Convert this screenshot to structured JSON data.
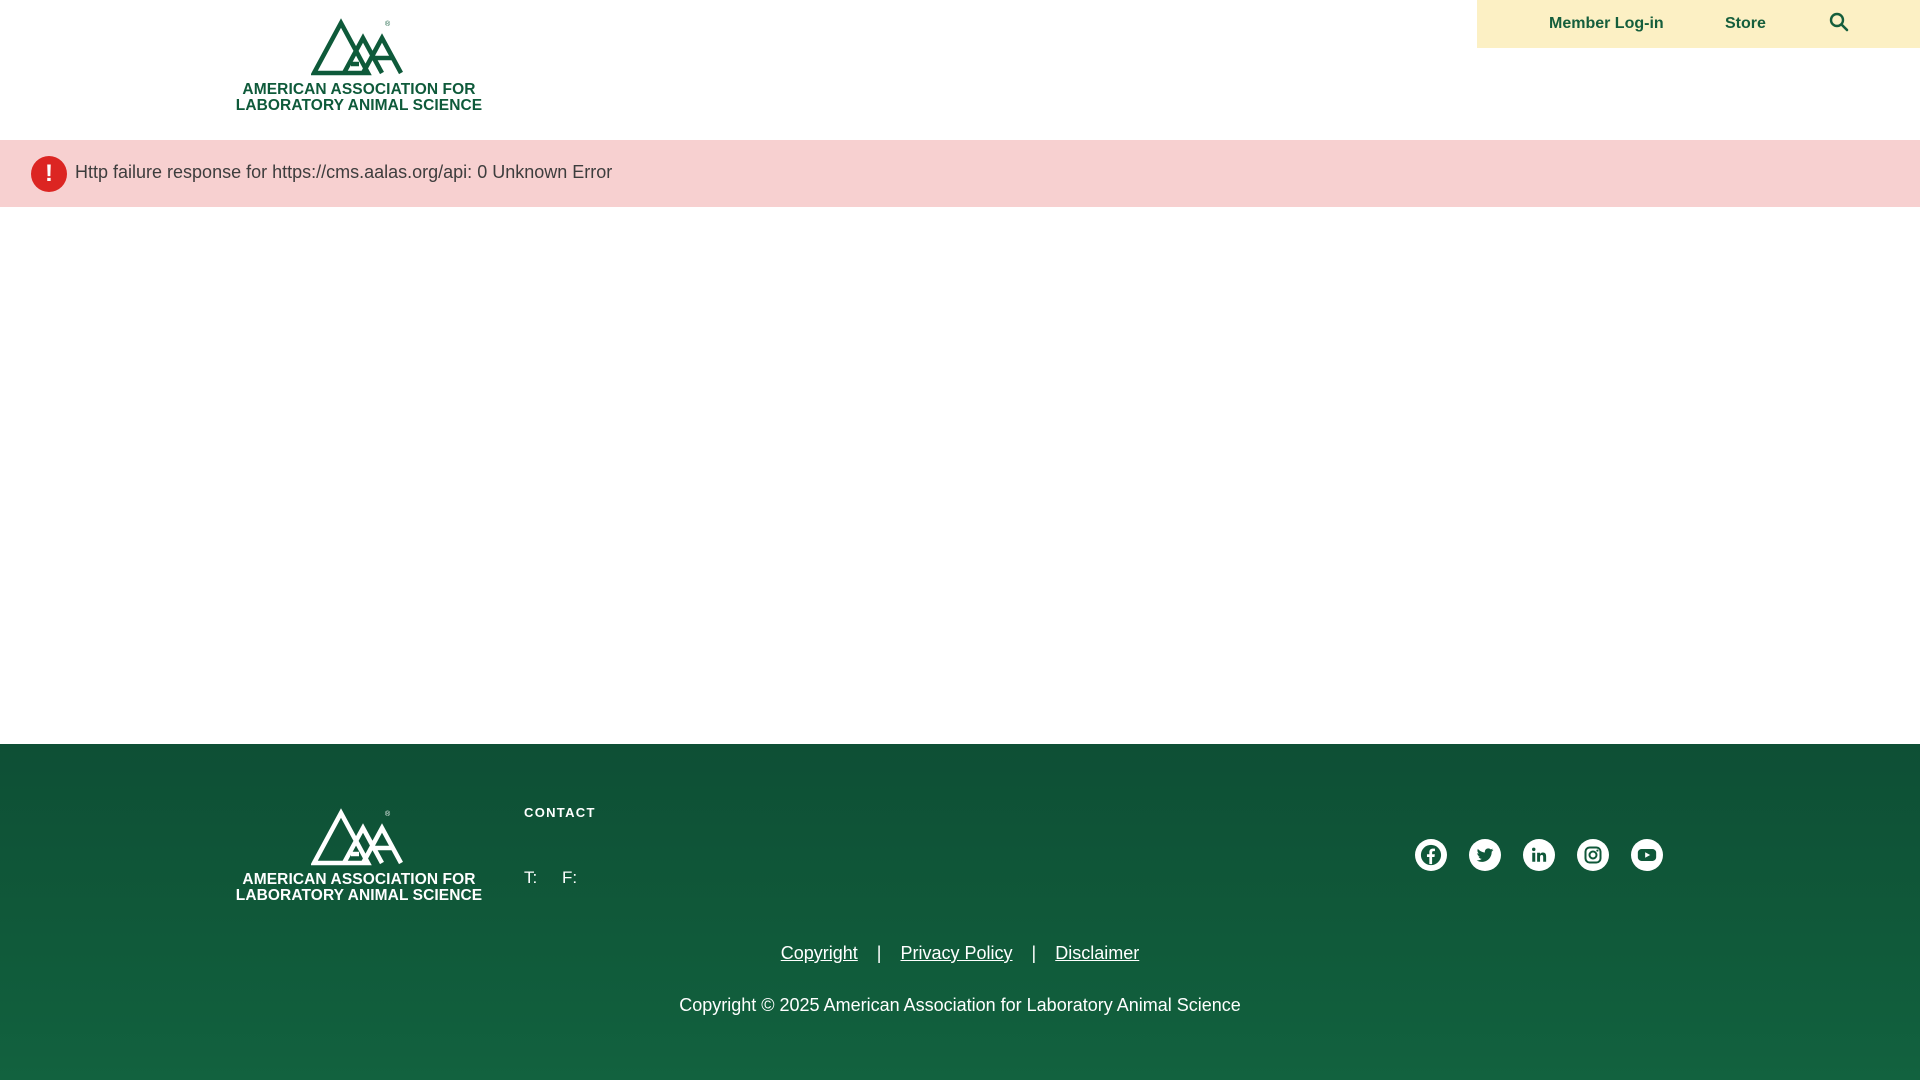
{
  "header": {
    "brand_line1": "AMERICAN ASSOCIATION FOR",
    "brand_line2": "LABORATORY ANIMAL SCIENCE",
    "logo_icon": "aalas-logo-icon",
    "utility_nav": {
      "member_login": "Member Log-in",
      "store": "Store",
      "search_icon": "search-icon"
    }
  },
  "error": {
    "icon": "exclamation-icon",
    "symbol": "!",
    "message": "Http failure response for https://cms.aalas.org/api: 0 Unknown Error"
  },
  "footer": {
    "brand_line1": "AMERICAN ASSOCIATION FOR",
    "brand_line2": "LABORATORY ANIMAL SCIENCE",
    "contact_heading": "CONTACT",
    "phone_label": "T:",
    "fax_label": "F:",
    "social": [
      "facebook-icon",
      "twitter-icon",
      "linkedin-icon",
      "instagram-icon",
      "youtube-icon"
    ],
    "legal_links": {
      "copyright": "Copyright",
      "privacy": "Privacy Policy",
      "disclaimer": "Disclaimer",
      "separator": "|"
    },
    "copyright_text": "Copyright © 2025 American Association for Laboratory Animal Science"
  },
  "colors": {
    "brand_green": "#0e5a3a",
    "utility_bg": "#fcf0c4",
    "error_bg": "#f7d0d0",
    "error_icon": "#dc2522",
    "footer_bg": "#105a3a"
  }
}
